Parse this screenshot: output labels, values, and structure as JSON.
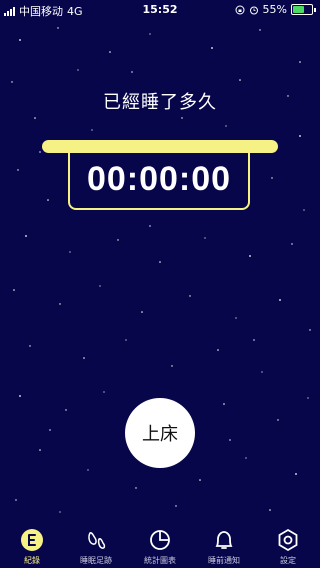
{
  "status_bar": {
    "carrier": "中国移动",
    "network": "4G",
    "time": "15:52",
    "battery_percent": "55%",
    "battery_level": 0.55,
    "battery_color": "#4cd964"
  },
  "main": {
    "title": "已經睡了多久",
    "timer": "00:00:00",
    "bed_button_label": "上床"
  },
  "tabs": [
    {
      "label": "紀錄",
      "icon": "record-icon",
      "active": true
    },
    {
      "label": "睡眠足跡",
      "icon": "footprint-icon",
      "active": false
    },
    {
      "label": "統計圖表",
      "icon": "pie-chart-icon",
      "active": false
    },
    {
      "label": "睡前通知",
      "icon": "bell-icon",
      "active": false
    },
    {
      "label": "設定",
      "icon": "gear-icon",
      "active": false
    }
  ],
  "colors": {
    "background": "#07064a",
    "accent": "#f6f184",
    "button": "#ffffff"
  }
}
